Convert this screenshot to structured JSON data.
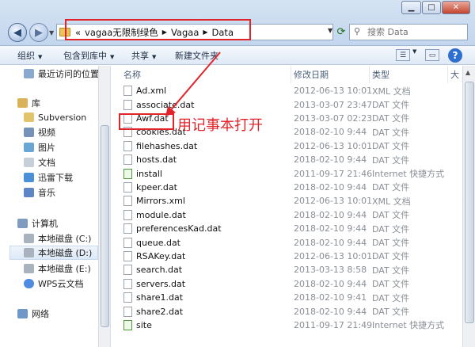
{
  "address": {
    "crumbs": [
      "vagaa无限制绿色",
      "Vagaa",
      "Data"
    ],
    "lead": "«"
  },
  "search": {
    "placeholder": "搜索 Data"
  },
  "toolbar": {
    "organize": "组织",
    "include_in_library": "包含到库中",
    "share": "共享",
    "new_folder": "新建文件夹"
  },
  "nav": {
    "recent": "最近访问的位置",
    "library": "库",
    "subversion": "Subversion",
    "video": "视频",
    "pictures": "图片",
    "documents": "文档",
    "xunlei": "迅雷下载",
    "music": "音乐",
    "computer": "计算机",
    "drive_c": "本地磁盘 (C:)",
    "drive_d": "本地磁盘 (D:)",
    "drive_e": "本地磁盘 (E:)",
    "wps": "WPS云文档",
    "network": "网络"
  },
  "columns": {
    "name": "名称",
    "date": "修改日期",
    "type": "类型",
    "size": "大"
  },
  "files": [
    {
      "name": "Ad.xml",
      "date": "2012-06-13 10:01",
      "type": "XML 文档"
    },
    {
      "name": "associate.dat",
      "date": "2013-03-07 23:47",
      "type": "DAT 文件"
    },
    {
      "name": "Awf.dat",
      "date": "2013-03-07 02:23",
      "type": "DAT 文件"
    },
    {
      "name": "cookies.dat",
      "date": "2018-02-10 9:44",
      "type": "DAT 文件"
    },
    {
      "name": "filehashes.dat",
      "date": "2012-06-13 10:01",
      "type": "DAT 文件"
    },
    {
      "name": "hosts.dat",
      "date": "2018-02-10 9:44",
      "type": "DAT 文件"
    },
    {
      "name": "install",
      "date": "2011-09-17 21:46",
      "type": "Internet 快捷方式"
    },
    {
      "name": "kpeer.dat",
      "date": "2018-02-10 9:44",
      "type": "DAT 文件"
    },
    {
      "name": "Mirrors.xml",
      "date": "2012-06-13 10:01",
      "type": "XML 文档"
    },
    {
      "name": "module.dat",
      "date": "2018-02-10 9:44",
      "type": "DAT 文件"
    },
    {
      "name": "preferencesKad.dat",
      "date": "2018-02-10 9:44",
      "type": "DAT 文件"
    },
    {
      "name": "queue.dat",
      "date": "2018-02-10 9:44",
      "type": "DAT 文件"
    },
    {
      "name": "RSAKey.dat",
      "date": "2012-06-13 10:01",
      "type": "DAT 文件"
    },
    {
      "name": "search.dat",
      "date": "2013-03-13 8:58",
      "type": "DAT 文件"
    },
    {
      "name": "servers.dat",
      "date": "2018-02-10 9:44",
      "type": "DAT 文件"
    },
    {
      "name": "share1.dat",
      "date": "2018-02-10 9:41",
      "type": "DAT 文件"
    },
    {
      "name": "share2.dat",
      "date": "2018-02-10 9:44",
      "type": "DAT 文件"
    },
    {
      "name": "site",
      "date": "2011-09-17 21:49",
      "type": "Internet 快捷方式"
    }
  ],
  "annotation": "用记事本打开",
  "colors": {
    "annotation_red": "#e1242a",
    "accent_blue": "#2f6fd0"
  }
}
